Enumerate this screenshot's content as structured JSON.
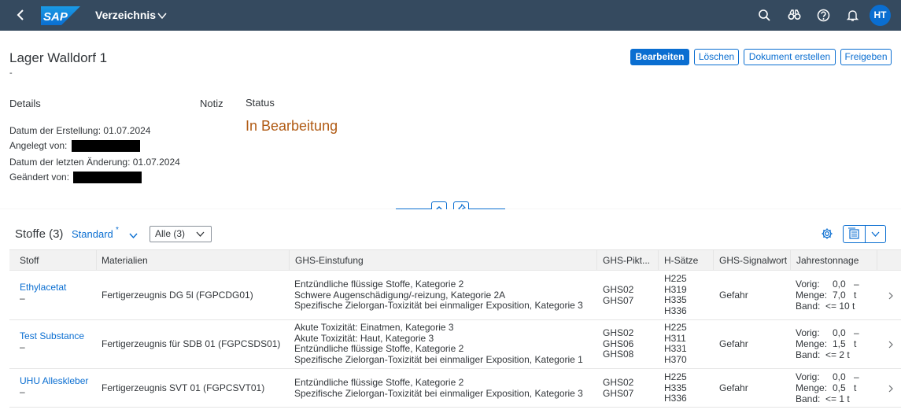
{
  "shell": {
    "logo_text": "SAP",
    "title": "Verzeichnis",
    "avatar_initials": "HT",
    "icons": [
      "search-icon",
      "binoculars-icon",
      "help-icon",
      "bell-icon"
    ]
  },
  "header": {
    "title": "Lager Walldorf 1",
    "subtitle": "-",
    "actions": {
      "edit": "Bearbeiten",
      "delete": "Löschen",
      "create_document": "Dokument erstellen",
      "release": "Freigeben"
    },
    "details": {
      "title": "Details",
      "created_date_label": "Datum der Erstellung:",
      "created_date": "01.07.2024",
      "created_by_label": "Angelegt von:",
      "changed_date_label": "Datum der letzten Änderung:",
      "changed_date": "01.07.2024",
      "changed_by_label": "Geändert von:"
    },
    "note": {
      "title": "Notiz"
    },
    "status": {
      "title": "Status",
      "value": "In Bearbeitung"
    }
  },
  "table": {
    "title": "Stoffe (3)",
    "variant": "Standard",
    "variant_modified": "*",
    "filter_value": "Alle (3)",
    "columns": [
      "Stoff",
      "Materialien",
      "GHS-Einstufung",
      "GHS-Pikt...",
      "H-Sätze",
      "GHS-Signalwort",
      "Jahrestonnage"
    ],
    "rows": [
      {
        "substance": "Ethylacetat",
        "substance_sub": "–",
        "material": "Fertigerzeugnis DG 5l (FGPCDG01)",
        "ghs_classification": [
          "Entzündliche flüssige Stoffe, Kategorie 2",
          "Schwere Augenschädigung/-reizung, Kategorie 2A",
          "Spezifische Zielorgan-Toxizität bei einmaliger Exposition, Kategorie 3"
        ],
        "pictograms": [
          "GHS02",
          "GHS07"
        ],
        "h_statements": [
          "H225",
          "H319",
          "H335",
          "H336"
        ],
        "signal_word": "Gefahr",
        "tonnage": [
          {
            "label": "Vorig:",
            "value": "0,0",
            "unit": "–"
          },
          {
            "label": "Menge:",
            "value": "7,0",
            "unit": "t"
          },
          {
            "label": "Band:",
            "value": "<= 10 t",
            "unit": ""
          }
        ]
      },
      {
        "substance": "Test Substance",
        "substance_sub": "–",
        "material": "Fertigerzeugnis für SDB 01 (FGPCSDS01)",
        "ghs_classification": [
          "Akute Toxizität: Einatmen, Kategorie 3",
          "Akute Toxizität: Haut, Kategorie 3",
          "Entzündliche flüssige Stoffe, Kategorie 2",
          "Spezifische Zielorgan-Toxizität bei einmaliger Exposition, Kategorie 1"
        ],
        "pictograms": [
          "GHS02",
          "GHS06",
          "GHS08"
        ],
        "h_statements": [
          "H225",
          "H311",
          "H331",
          "H370"
        ],
        "signal_word": "Gefahr",
        "tonnage": [
          {
            "label": "Vorig:",
            "value": "0,0",
            "unit": "–"
          },
          {
            "label": "Menge:",
            "value": "1,5",
            "unit": "t"
          },
          {
            "label": "Band:",
            "value": "<= 2 t",
            "unit": ""
          }
        ]
      },
      {
        "substance": "UHU Alleskleber",
        "substance_sub": "–",
        "material": "Fertigerzeugnis SVT 01 (FGPCSVT01)",
        "ghs_classification": [
          "Entzündliche flüssige Stoffe, Kategorie 2",
          "Spezifische Zielorgan-Toxizität bei einmaliger Exposition, Kategorie 3"
        ],
        "pictograms": [
          "GHS02",
          "GHS07"
        ],
        "h_statements": [
          "H225",
          "H335",
          "H336"
        ],
        "signal_word": "Gefahr",
        "tonnage": [
          {
            "label": "Vorig:",
            "value": "0,0",
            "unit": "–"
          },
          {
            "label": "Menge:",
            "value": "0,5",
            "unit": "t"
          },
          {
            "label": "Band:",
            "value": "<= 1 t",
            "unit": ""
          }
        ]
      }
    ]
  },
  "colors": {
    "shell_bg": "#354a5f",
    "accent": "#0a6ed1",
    "status_in_progress": "#b05a13"
  }
}
